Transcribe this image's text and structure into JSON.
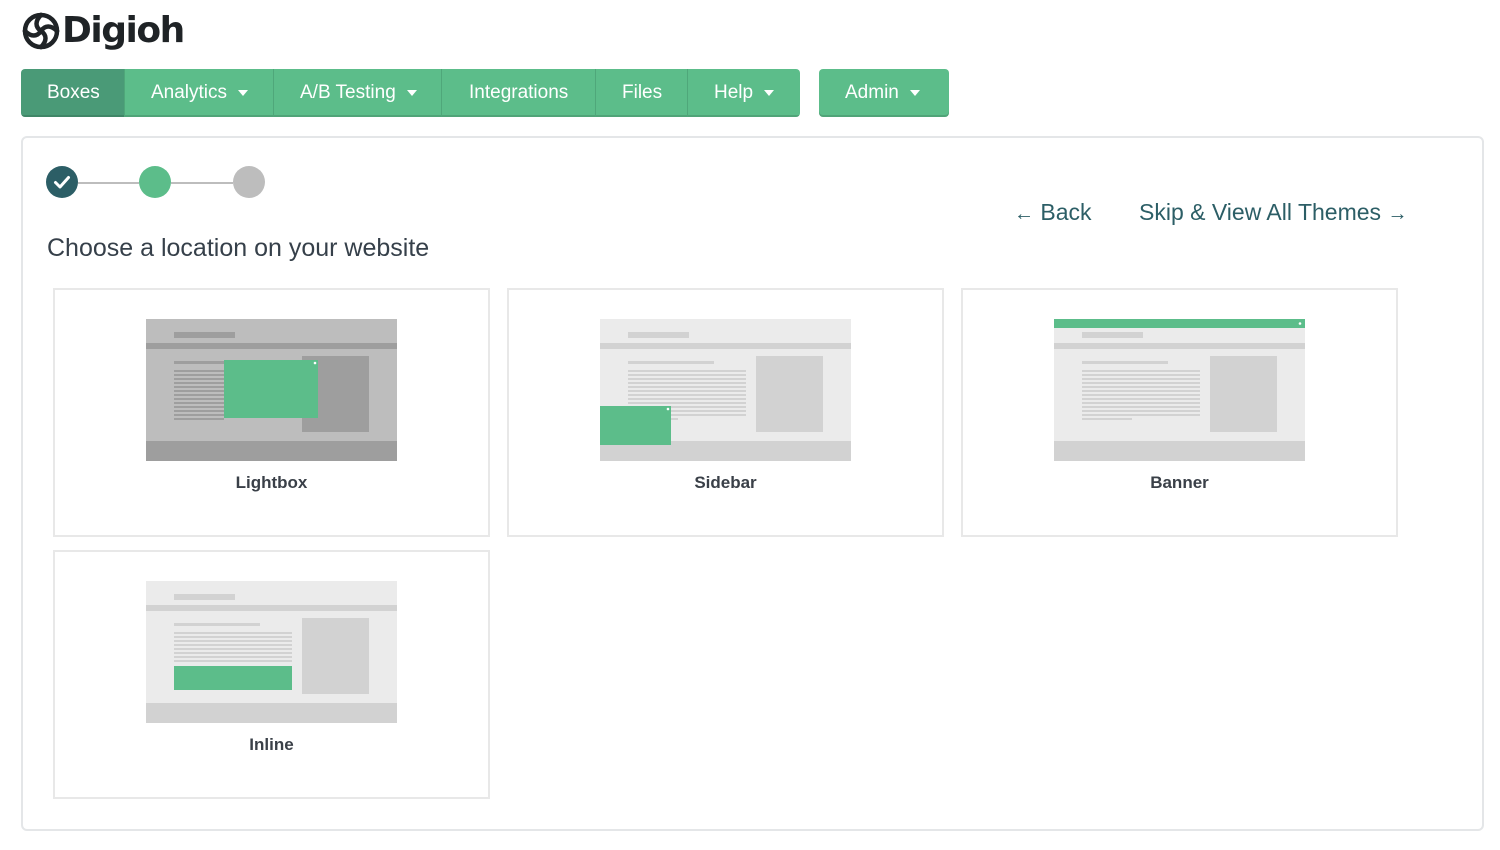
{
  "logo": {
    "text": "Digioh",
    "icon": "digioh-logo-icon"
  },
  "nav": {
    "items": [
      {
        "label": "Boxes",
        "active": true,
        "dropdown": false
      },
      {
        "label": "Analytics",
        "active": false,
        "dropdown": true
      },
      {
        "label": "A/B Testing",
        "active": false,
        "dropdown": true
      },
      {
        "label": "Integrations",
        "active": false,
        "dropdown": false
      },
      {
        "label": "Files",
        "active": false,
        "dropdown": false
      },
      {
        "label": "Help",
        "active": false,
        "dropdown": true
      }
    ],
    "admin": {
      "label": "Admin",
      "dropdown": true
    }
  },
  "wizard": {
    "steps": [
      {
        "state": "completed",
        "icon": "check-icon"
      },
      {
        "state": "current"
      },
      {
        "state": "upcoming"
      }
    ],
    "heading": "Choose a location on your website",
    "back": {
      "arrow": "←",
      "label": "Back"
    },
    "skip": {
      "label": "Skip & View All Themes",
      "arrow": "→"
    }
  },
  "locations": [
    {
      "label": "Lightbox"
    },
    {
      "label": "Sidebar"
    },
    {
      "label": "Banner"
    },
    {
      "label": "Inline"
    }
  ],
  "colors": {
    "brand_green": "#5cbd8a",
    "active_nav": "#4a9a77",
    "dark_teal": "#2c5e66",
    "upcoming_step": "#bdbdbd"
  }
}
